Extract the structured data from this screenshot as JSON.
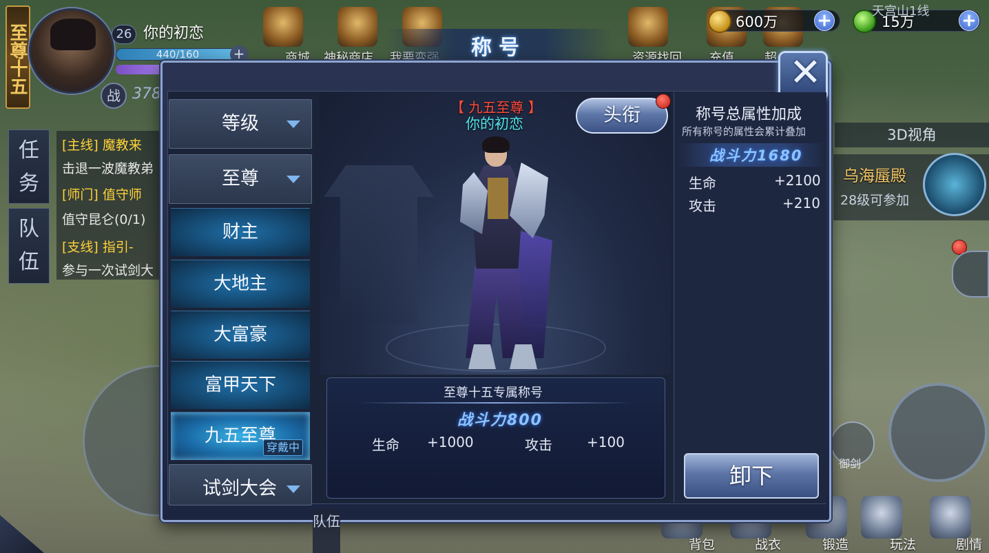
{
  "hud": {
    "rank_banner": "至尊十五",
    "level": "26",
    "player_name": "你的初恋",
    "hp": "440/160",
    "hp_plus": "+",
    "battle_icon": "战",
    "battle_power_partial": "378",
    "tabs": {
      "task": "任务",
      "team": "队伍"
    },
    "quests": [
      {
        "text": "[主线] 魔教来",
        "color": "#ffd23a"
      },
      {
        "text": "击退一波魔教弟",
        "color": "#e8e8e8"
      },
      {
        "text": "[师门] 值守师",
        "color": "#ffd23a"
      },
      {
        "text": "值守昆仑(0/1)",
        "color": "#e8e8e8"
      },
      {
        "text": "[支线] 指引-",
        "color": "#ffd23a"
      },
      {
        "text": "参与一次试剑大",
        "color": "#e8e8e8"
      }
    ],
    "top_menu": [
      "商城",
      "神秘商店",
      "我要变强",
      "资源找回",
      "充值",
      "超"
    ],
    "currency": [
      {
        "value": "600万",
        "icon": "copper-coin-icon",
        "color": "#f2c232"
      },
      {
        "value": "15万",
        "icon": "jade-coin-icon",
        "color": "#6ad23a"
      }
    ],
    "currency_plus": "+",
    "server_line": "天宫山1线",
    "view_button": "3D视角",
    "event_title": "乌海蜃殿",
    "event_sub": "28级可参加",
    "skill_label": "御剑",
    "bottom_menu": [
      "背包",
      "战衣",
      "锻造",
      "玩法",
      "剧情"
    ],
    "team_bottom": "队伍"
  },
  "dialog": {
    "title": "称号",
    "close_label": "✕",
    "categories": [
      {
        "label": "等级",
        "expandable": true
      },
      {
        "label": "至尊",
        "expandable": true
      }
    ],
    "titles": [
      {
        "label": "财主",
        "selected": false
      },
      {
        "label": "大地主",
        "selected": false
      },
      {
        "label": "大富豪",
        "selected": false
      },
      {
        "label": "富甲天下",
        "selected": false
      },
      {
        "label": "九五至尊",
        "selected": true
      }
    ],
    "bottom_category": {
      "label": "试剑大会",
      "expandable": true
    },
    "wearing_tag": "穿戴中",
    "preview": {
      "title_text": "【 九五至尊 】",
      "title_color": "#ff4a3a",
      "name": "你的初恋",
      "name_color": "#4fe4e8"
    },
    "head_button": "头衔",
    "title_info": {
      "header": "至尊十五专属称号",
      "power": "战斗力800",
      "stats": [
        {
          "label": "生命",
          "value": "+1000"
        },
        {
          "label": "攻击",
          "value": "+100"
        }
      ]
    },
    "total_bonus": {
      "title": "称号总属性加成",
      "subtitle": "所有称号的属性会累计叠加",
      "power": "战斗力1680",
      "stats": [
        {
          "label": "生命",
          "value": "+2100"
        },
        {
          "label": "攻击",
          "value": "+210"
        }
      ]
    },
    "unequip_button": "卸下"
  }
}
